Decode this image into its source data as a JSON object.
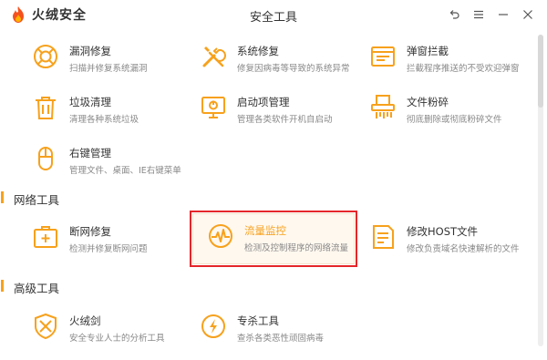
{
  "app": {
    "name": "火绒安全",
    "window_title": "安全工具"
  },
  "window_controls": [
    {
      "name": "back-icon"
    },
    {
      "name": "menu-icon"
    },
    {
      "name": "minimize-icon"
    },
    {
      "name": "close-icon"
    }
  ],
  "colors": {
    "accent": "#f7a11c",
    "highlight": "#e5262a"
  },
  "sections": {
    "network": "网络工具",
    "advanced": "高级工具"
  },
  "tools": {
    "leak": {
      "name": "漏洞修复",
      "desc": "扫描并修复系统漏洞",
      "icon": "lifebuoy-icon"
    },
    "sysfix": {
      "name": "系统修复",
      "desc": "修复因病毒等导致的系统异常",
      "icon": "wrench-screwdriver-icon"
    },
    "popup": {
      "name": "弹窗拦截",
      "desc": "拦截程序推送的不受欢迎弹窗",
      "icon": "window-block-icon"
    },
    "junk": {
      "name": "垃圾清理",
      "desc": "清理各种系统垃圾",
      "icon": "trash-icon"
    },
    "startup": {
      "name": "启动项管理",
      "desc": "管理各类软件开机自启动",
      "icon": "monitor-icon"
    },
    "shred": {
      "name": "文件粉碎",
      "desc": "彻底删除或彻底粉碎文件",
      "icon": "shredder-icon"
    },
    "rightclick": {
      "name": "右键管理",
      "desc": "管理文件、桌面、IE右键菜单",
      "icon": "mouse-icon"
    },
    "netfix": {
      "name": "断网修复",
      "desc": "检测并修复断网问题",
      "icon": "medkit-icon"
    },
    "traffic": {
      "name": "流量监控",
      "desc": "检测及控制程序的网络流量",
      "icon": "pulse-icon"
    },
    "hosts": {
      "name": "修改HOST文件",
      "desc": "修改负责域名快速解析的文件",
      "icon": "document-edit-icon"
    },
    "sword": {
      "name": "火绒剑",
      "desc": "安全专业人士的分析工具",
      "icon": "crossed-swords-icon"
    },
    "killer": {
      "name": "专杀工具",
      "desc": "查杀各类恶性顽固病毒",
      "icon": "shield-bolt-icon"
    }
  }
}
